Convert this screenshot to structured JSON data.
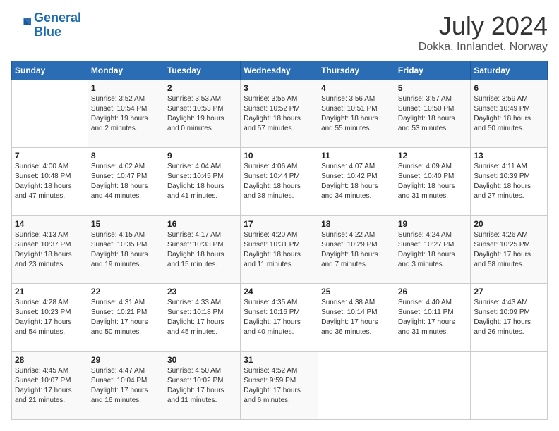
{
  "header": {
    "logo_line1": "General",
    "logo_line2": "Blue",
    "title": "July 2024",
    "subtitle": "Dokka, Innlandet, Norway"
  },
  "calendar": {
    "weekdays": [
      "Sunday",
      "Monday",
      "Tuesday",
      "Wednesday",
      "Thursday",
      "Friday",
      "Saturday"
    ],
    "weeks": [
      [
        {
          "day": "",
          "info": ""
        },
        {
          "day": "1",
          "info": "Sunrise: 3:52 AM\nSunset: 10:54 PM\nDaylight: 19 hours\nand 2 minutes."
        },
        {
          "day": "2",
          "info": "Sunrise: 3:53 AM\nSunset: 10:53 PM\nDaylight: 19 hours\nand 0 minutes."
        },
        {
          "day": "3",
          "info": "Sunrise: 3:55 AM\nSunset: 10:52 PM\nDaylight: 18 hours\nand 57 minutes."
        },
        {
          "day": "4",
          "info": "Sunrise: 3:56 AM\nSunset: 10:51 PM\nDaylight: 18 hours\nand 55 minutes."
        },
        {
          "day": "5",
          "info": "Sunrise: 3:57 AM\nSunset: 10:50 PM\nDaylight: 18 hours\nand 53 minutes."
        },
        {
          "day": "6",
          "info": "Sunrise: 3:59 AM\nSunset: 10:49 PM\nDaylight: 18 hours\nand 50 minutes."
        }
      ],
      [
        {
          "day": "7",
          "info": "Sunrise: 4:00 AM\nSunset: 10:48 PM\nDaylight: 18 hours\nand 47 minutes."
        },
        {
          "day": "8",
          "info": "Sunrise: 4:02 AM\nSunset: 10:47 PM\nDaylight: 18 hours\nand 44 minutes."
        },
        {
          "day": "9",
          "info": "Sunrise: 4:04 AM\nSunset: 10:45 PM\nDaylight: 18 hours\nand 41 minutes."
        },
        {
          "day": "10",
          "info": "Sunrise: 4:06 AM\nSunset: 10:44 PM\nDaylight: 18 hours\nand 38 minutes."
        },
        {
          "day": "11",
          "info": "Sunrise: 4:07 AM\nSunset: 10:42 PM\nDaylight: 18 hours\nand 34 minutes."
        },
        {
          "day": "12",
          "info": "Sunrise: 4:09 AM\nSunset: 10:40 PM\nDaylight: 18 hours\nand 31 minutes."
        },
        {
          "day": "13",
          "info": "Sunrise: 4:11 AM\nSunset: 10:39 PM\nDaylight: 18 hours\nand 27 minutes."
        }
      ],
      [
        {
          "day": "14",
          "info": "Sunrise: 4:13 AM\nSunset: 10:37 PM\nDaylight: 18 hours\nand 23 minutes."
        },
        {
          "day": "15",
          "info": "Sunrise: 4:15 AM\nSunset: 10:35 PM\nDaylight: 18 hours\nand 19 minutes."
        },
        {
          "day": "16",
          "info": "Sunrise: 4:17 AM\nSunset: 10:33 PM\nDaylight: 18 hours\nand 15 minutes."
        },
        {
          "day": "17",
          "info": "Sunrise: 4:20 AM\nSunset: 10:31 PM\nDaylight: 18 hours\nand 11 minutes."
        },
        {
          "day": "18",
          "info": "Sunrise: 4:22 AM\nSunset: 10:29 PM\nDaylight: 18 hours\nand 7 minutes."
        },
        {
          "day": "19",
          "info": "Sunrise: 4:24 AM\nSunset: 10:27 PM\nDaylight: 18 hours\nand 3 minutes."
        },
        {
          "day": "20",
          "info": "Sunrise: 4:26 AM\nSunset: 10:25 PM\nDaylight: 17 hours\nand 58 minutes."
        }
      ],
      [
        {
          "day": "21",
          "info": "Sunrise: 4:28 AM\nSunset: 10:23 PM\nDaylight: 17 hours\nand 54 minutes."
        },
        {
          "day": "22",
          "info": "Sunrise: 4:31 AM\nSunset: 10:21 PM\nDaylight: 17 hours\nand 50 minutes."
        },
        {
          "day": "23",
          "info": "Sunrise: 4:33 AM\nSunset: 10:18 PM\nDaylight: 17 hours\nand 45 minutes."
        },
        {
          "day": "24",
          "info": "Sunrise: 4:35 AM\nSunset: 10:16 PM\nDaylight: 17 hours\nand 40 minutes."
        },
        {
          "day": "25",
          "info": "Sunrise: 4:38 AM\nSunset: 10:14 PM\nDaylight: 17 hours\nand 36 minutes."
        },
        {
          "day": "26",
          "info": "Sunrise: 4:40 AM\nSunset: 10:11 PM\nDaylight: 17 hours\nand 31 minutes."
        },
        {
          "day": "27",
          "info": "Sunrise: 4:43 AM\nSunset: 10:09 PM\nDaylight: 17 hours\nand 26 minutes."
        }
      ],
      [
        {
          "day": "28",
          "info": "Sunrise: 4:45 AM\nSunset: 10:07 PM\nDaylight: 17 hours\nand 21 minutes."
        },
        {
          "day": "29",
          "info": "Sunrise: 4:47 AM\nSunset: 10:04 PM\nDaylight: 17 hours\nand 16 minutes."
        },
        {
          "day": "30",
          "info": "Sunrise: 4:50 AM\nSunset: 10:02 PM\nDaylight: 17 hours\nand 11 minutes."
        },
        {
          "day": "31",
          "info": "Sunrise: 4:52 AM\nSunset: 9:59 PM\nDaylight: 17 hours\nand 6 minutes."
        },
        {
          "day": "",
          "info": ""
        },
        {
          "day": "",
          "info": ""
        },
        {
          "day": "",
          "info": ""
        }
      ]
    ]
  }
}
